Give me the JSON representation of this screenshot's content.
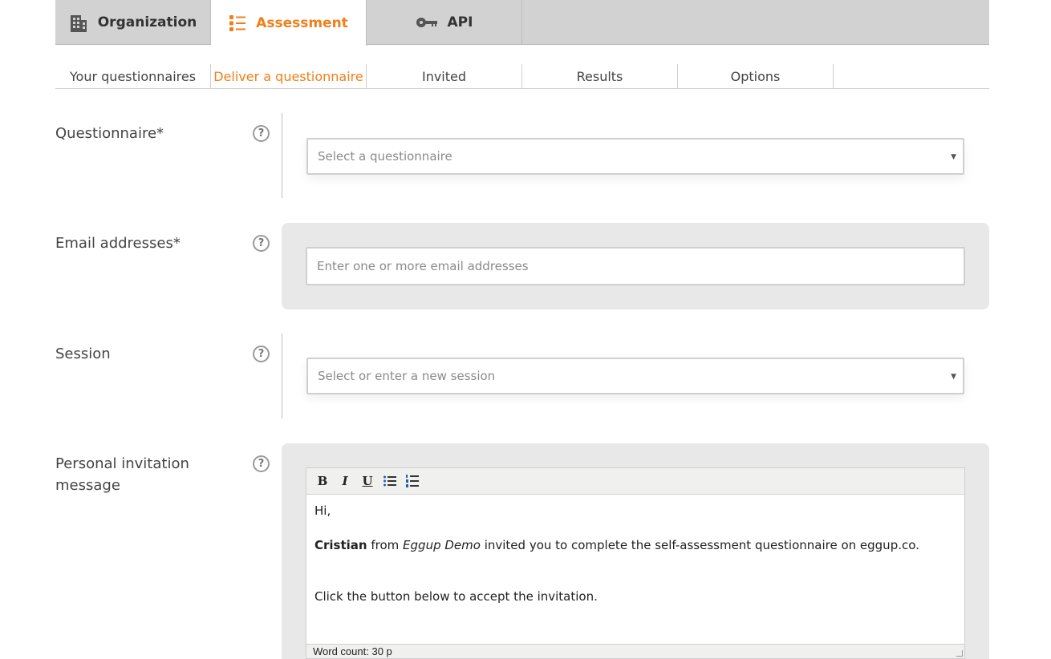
{
  "top_tabs": [
    {
      "label": "Organization",
      "icon": "building-icon",
      "active": false
    },
    {
      "label": "Assessment",
      "icon": "list-icon",
      "active": true
    },
    {
      "label": "API",
      "icon": "key-icon",
      "active": false
    }
  ],
  "sub_tabs": [
    {
      "label": "Your questionnaires",
      "active": false
    },
    {
      "label": "Deliver a questionnaire",
      "active": true
    },
    {
      "label": "Invited",
      "active": false
    },
    {
      "label": "Results",
      "active": false
    },
    {
      "label": "Options",
      "active": false
    }
  ],
  "form": {
    "questionnaire": {
      "label": "Questionnaire*",
      "placeholder": "Select a questionnaire"
    },
    "emails": {
      "label": "Email addresses*",
      "placeholder": "Enter one or more email addresses"
    },
    "session": {
      "label": "Session",
      "placeholder": "Select or enter a new session"
    },
    "message": {
      "label_line1": "Personal invitation",
      "label_line2": "message",
      "greeting": "Hi,",
      "sender": "Cristian",
      "from_word": " from ",
      "org": "Eggup Demo",
      "invite_text": " invited you to complete the self-assessment questionnaire on eggup.co.",
      "accept_text": "Click the button below to accept the invitation.",
      "word_count": "Word count: 30 p"
    }
  },
  "help_glyph": "?",
  "colors": {
    "accent": "#f07f1a",
    "tab_bar": "#d2d2d2",
    "panel": "#e8e8e8"
  }
}
